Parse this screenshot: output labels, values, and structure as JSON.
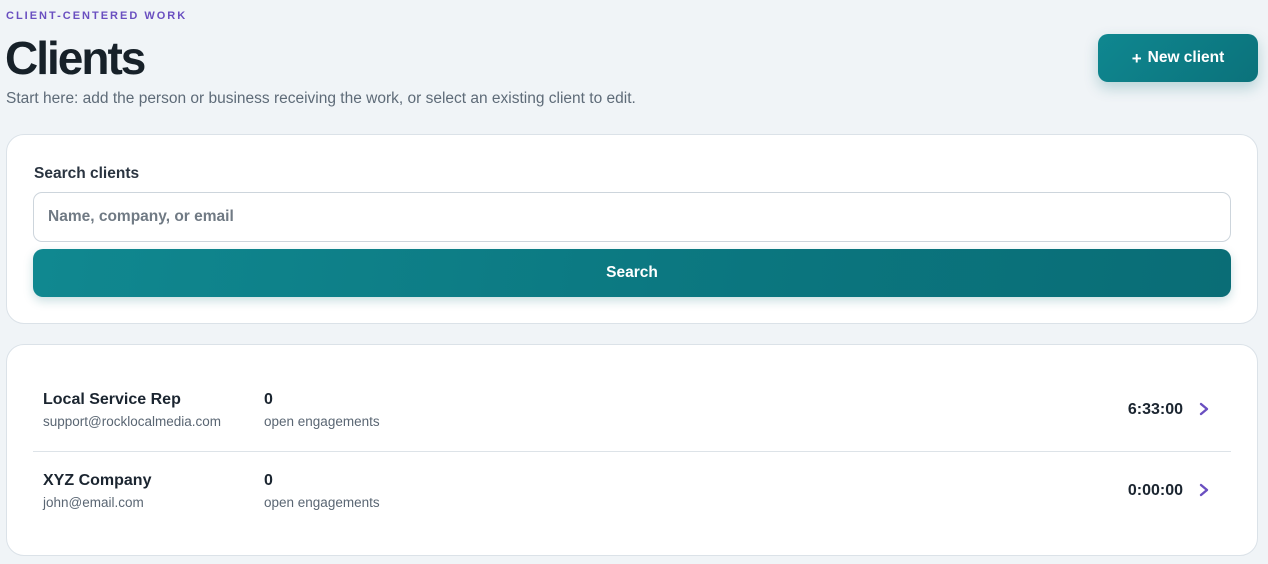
{
  "header": {
    "eyebrow": "CLIENT-CENTERED WORK",
    "title": "Clients",
    "subtitle": "Start here: add the person or business receiving the work, or select an existing client to edit.",
    "new_client_plus": "+",
    "new_client_label": "New client"
  },
  "search": {
    "label": "Search clients",
    "placeholder": "Name, company, or email",
    "value": "",
    "button_label": "Search"
  },
  "clients": [
    {
      "name": "Local Service Rep",
      "email": "support@rocklocalmedia.com",
      "open_engagements": "0",
      "open_engagements_label": "open engagements",
      "time": "6:33:00"
    },
    {
      "name": "XYZ Company",
      "email": "john@email.com",
      "open_engagements": "0",
      "open_engagements_label": "open engagements",
      "time": "0:00:00"
    }
  ],
  "colors": {
    "accent": "#0d7f88",
    "eyebrow": "#6a4fc0",
    "chevron": "#6a4fc0",
    "background": "#f0f4f7"
  },
  "icons": {
    "row_action": "chevron-right-icon",
    "new_client": "plus-icon"
  }
}
